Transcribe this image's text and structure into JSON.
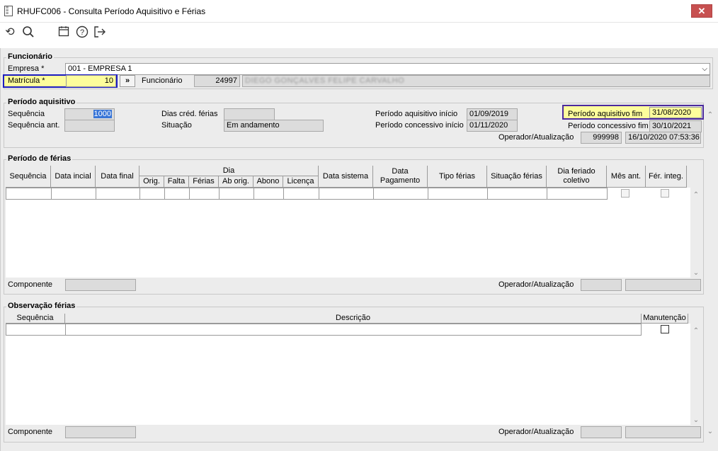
{
  "window": {
    "title": "RHUFC006 - Consulta Período Aquisitivo e Férias",
    "close_label": "✕"
  },
  "funcionario": {
    "legend": "Funcionário",
    "empresa_label": "Empresa *",
    "empresa_value": "001 - EMPRESA 1",
    "matricula_label": "Matrícula *",
    "matricula_value": "10",
    "go_label": "»",
    "funcionario_label": "Funcionário",
    "funcionario_code": "24997",
    "funcionario_name": "DIEGO GONÇALVES FELIPE CARVALHO"
  },
  "periodo_aquisitivo": {
    "legend": "Período aquisitivo",
    "sequencia_label": "Sequência",
    "sequencia_value": "1000",
    "sequencia_ant_label": "Sequência ant.",
    "dias_cred_label": "Dias créd. férias",
    "situacao_label": "Situação",
    "situacao_value": "Em andamento",
    "inicio_label": "Período aquisitivo início",
    "inicio_value": "01/09/2019",
    "concessivo_inicio_label": "Período concessivo início",
    "concessivo_inicio_value": "01/11/2020",
    "fim_label": "Período aquisitivo fim",
    "fim_value": "31/08/2020",
    "concessivo_fim_label": "Período concessivo fim",
    "concessivo_fim_value": "30/10/2021",
    "operador_label": "Operador/Atualização",
    "operador_value": "999998",
    "atualizacao_value": "16/10/2020 07:53:36"
  },
  "periodo_ferias": {
    "legend": "Período de férias",
    "dia_group": "Dia",
    "columns": [
      "Sequência",
      "Data incial",
      "Data final",
      "Orig.",
      "Falta",
      "Férias",
      "Ab orig.",
      "Abono",
      "Licença",
      "Data sistema",
      "Data Pagamento",
      "Tipo férias",
      "Situação férias",
      "Dia feriado coletivo",
      "Mês ant.",
      "Fér. integ."
    ],
    "componente_label": "Componente",
    "operador_label": "Operador/Atualização"
  },
  "observacao": {
    "legend": "Observação férias",
    "columns": [
      "Sequência",
      "Descrição",
      "Manutenção"
    ],
    "componente_label": "Componente",
    "operador_label": "Operador/Atualização"
  },
  "icons": {
    "doc": "document-icon",
    "refresh": "refresh-icon",
    "search": "search-icon",
    "calendar": "calendar-icon",
    "help": "help-icon",
    "exit": "exit-icon"
  }
}
